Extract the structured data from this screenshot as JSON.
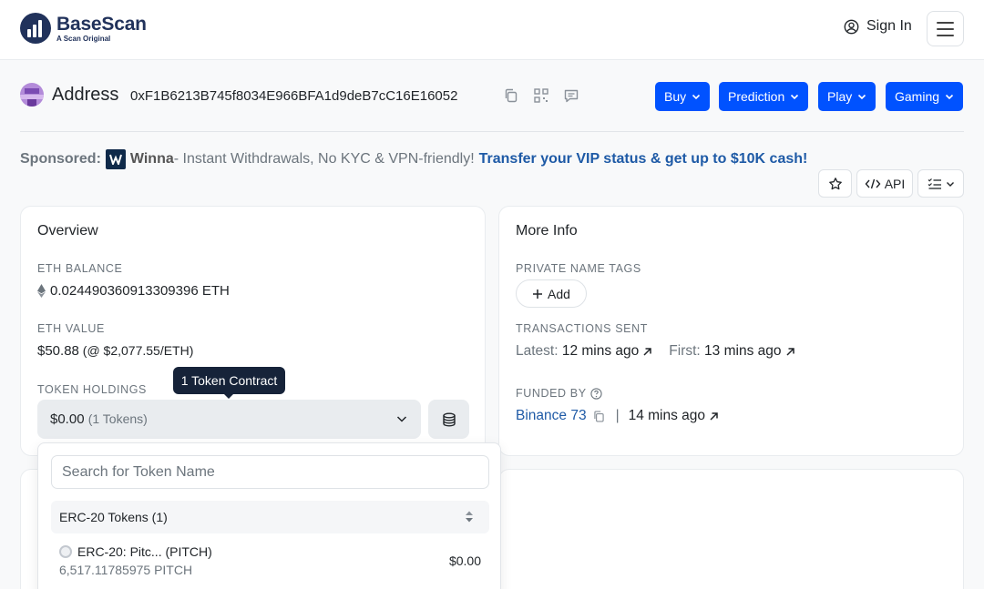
{
  "header": {
    "logo_name": "BaseScan",
    "logo_tagline": "A Scan Original",
    "sign_in": "Sign In"
  },
  "address": {
    "label": "Address",
    "hash": "0xF1B6213B745f8034E966BFA1d9deB7cC16E16052",
    "buttons": [
      {
        "label": "Buy"
      },
      {
        "label": "Prediction"
      },
      {
        "label": "Play"
      },
      {
        "label": "Gaming"
      }
    ]
  },
  "sponsored": {
    "label": "Sponsored:",
    "brand": "Winna",
    "text": " - Instant Withdrawals, No KYC & VPN-friendly!",
    "cta": "Transfer your VIP status & get up to $10K cash!"
  },
  "toolbar": {
    "api_label": "API"
  },
  "overview": {
    "title": "Overview",
    "eth_balance_label": "ETH BALANCE",
    "eth_balance_value": "0.024490360913309396 ETH",
    "eth_value_label": "ETH VALUE",
    "eth_value_value": "$50.88",
    "eth_value_rate": " (@ $2,077.55/ETH)",
    "token_holdings_label": "TOKEN HOLDINGS",
    "token_value": "$0.00",
    "token_count": "(1 Tokens)",
    "tooltip": "1 Token Contract"
  },
  "more_info": {
    "title": "More Info",
    "private_tags_label": "PRIVATE NAME TAGS",
    "add_label": "Add",
    "tx_sent_label": "TRANSACTIONS SENT",
    "latest_label": "Latest:",
    "latest_value": "12 mins ago",
    "first_label": "First:",
    "first_value": "13 mins ago",
    "funded_by_label": "FUNDED BY",
    "funded_by_name": "Binance 73",
    "funded_separator": "|",
    "funded_time": "14 mins ago"
  },
  "dropdown": {
    "search_placeholder": "Search for Token Name",
    "group_label": "ERC-20 Tokens (1)",
    "tokens": [
      {
        "name": "ERC-20: Pitc... (PITCH)",
        "amount": "6,517.11785975 PITCH",
        "usd": "$0.00"
      }
    ]
  },
  "colors": {
    "accent": "#0052ff",
    "link": "#1e5aa6",
    "brand": "#21325b"
  }
}
